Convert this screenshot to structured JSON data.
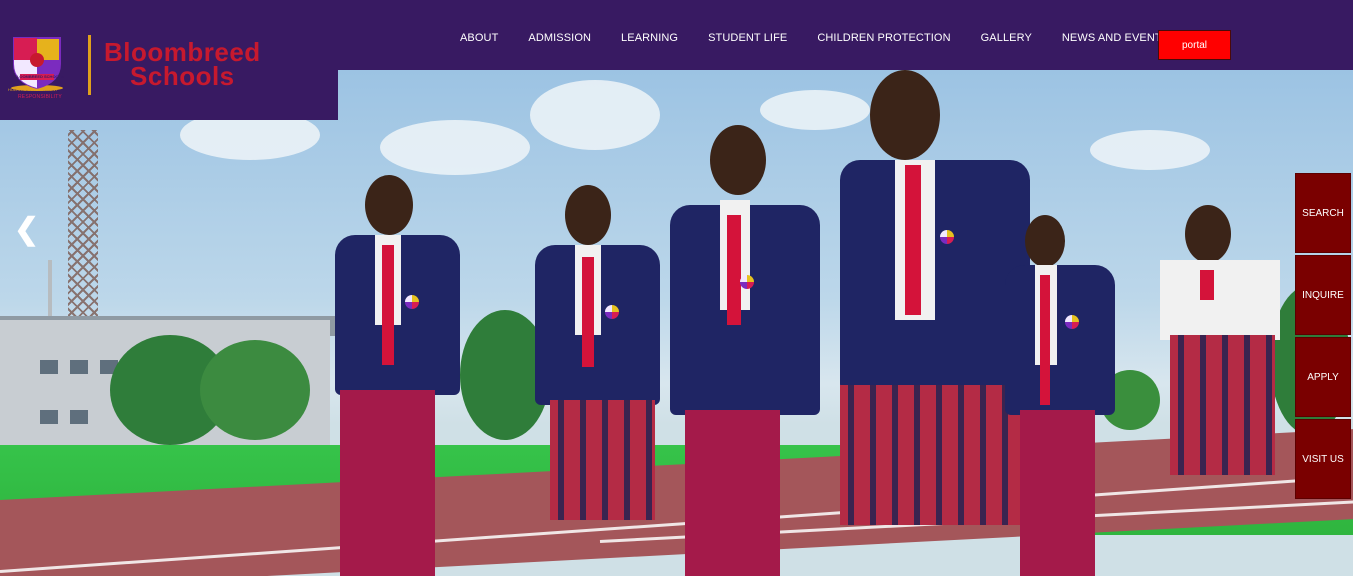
{
  "brand": {
    "name_line1": "Bloombreed",
    "name_line2": "Schools",
    "crest_motto": "RESPONSIBILITY",
    "crest_school_text": "BLOOMBREED SCHOOLS",
    "crest_tagline": "HOLISTIC DEVELOPMENT",
    "colors": {
      "header_bg": "#381a62",
      "brand_red": "#c7192e",
      "gold": "#e0a11c",
      "portal_red": "#ff0000",
      "side_btn": "#7a0000"
    }
  },
  "nav": {
    "items": [
      {
        "label": "ABOUT"
      },
      {
        "label": "ADMISSION"
      },
      {
        "label": "LEARNING"
      },
      {
        "label": "STUDENT LIFE"
      },
      {
        "label": "CHILDREN PROTECTION"
      },
      {
        "label": "GALLERY"
      },
      {
        "label": "NEWS AND EVENTS"
      }
    ],
    "portal_label": "portal"
  },
  "hero": {
    "prev_icon": "chevron-left-icon",
    "prev_glyph": "❮"
  },
  "side_actions": [
    {
      "label": "SEARCH"
    },
    {
      "label": "INQUIRE"
    },
    {
      "label": "APPLY"
    },
    {
      "label": "VISIT US"
    }
  ]
}
